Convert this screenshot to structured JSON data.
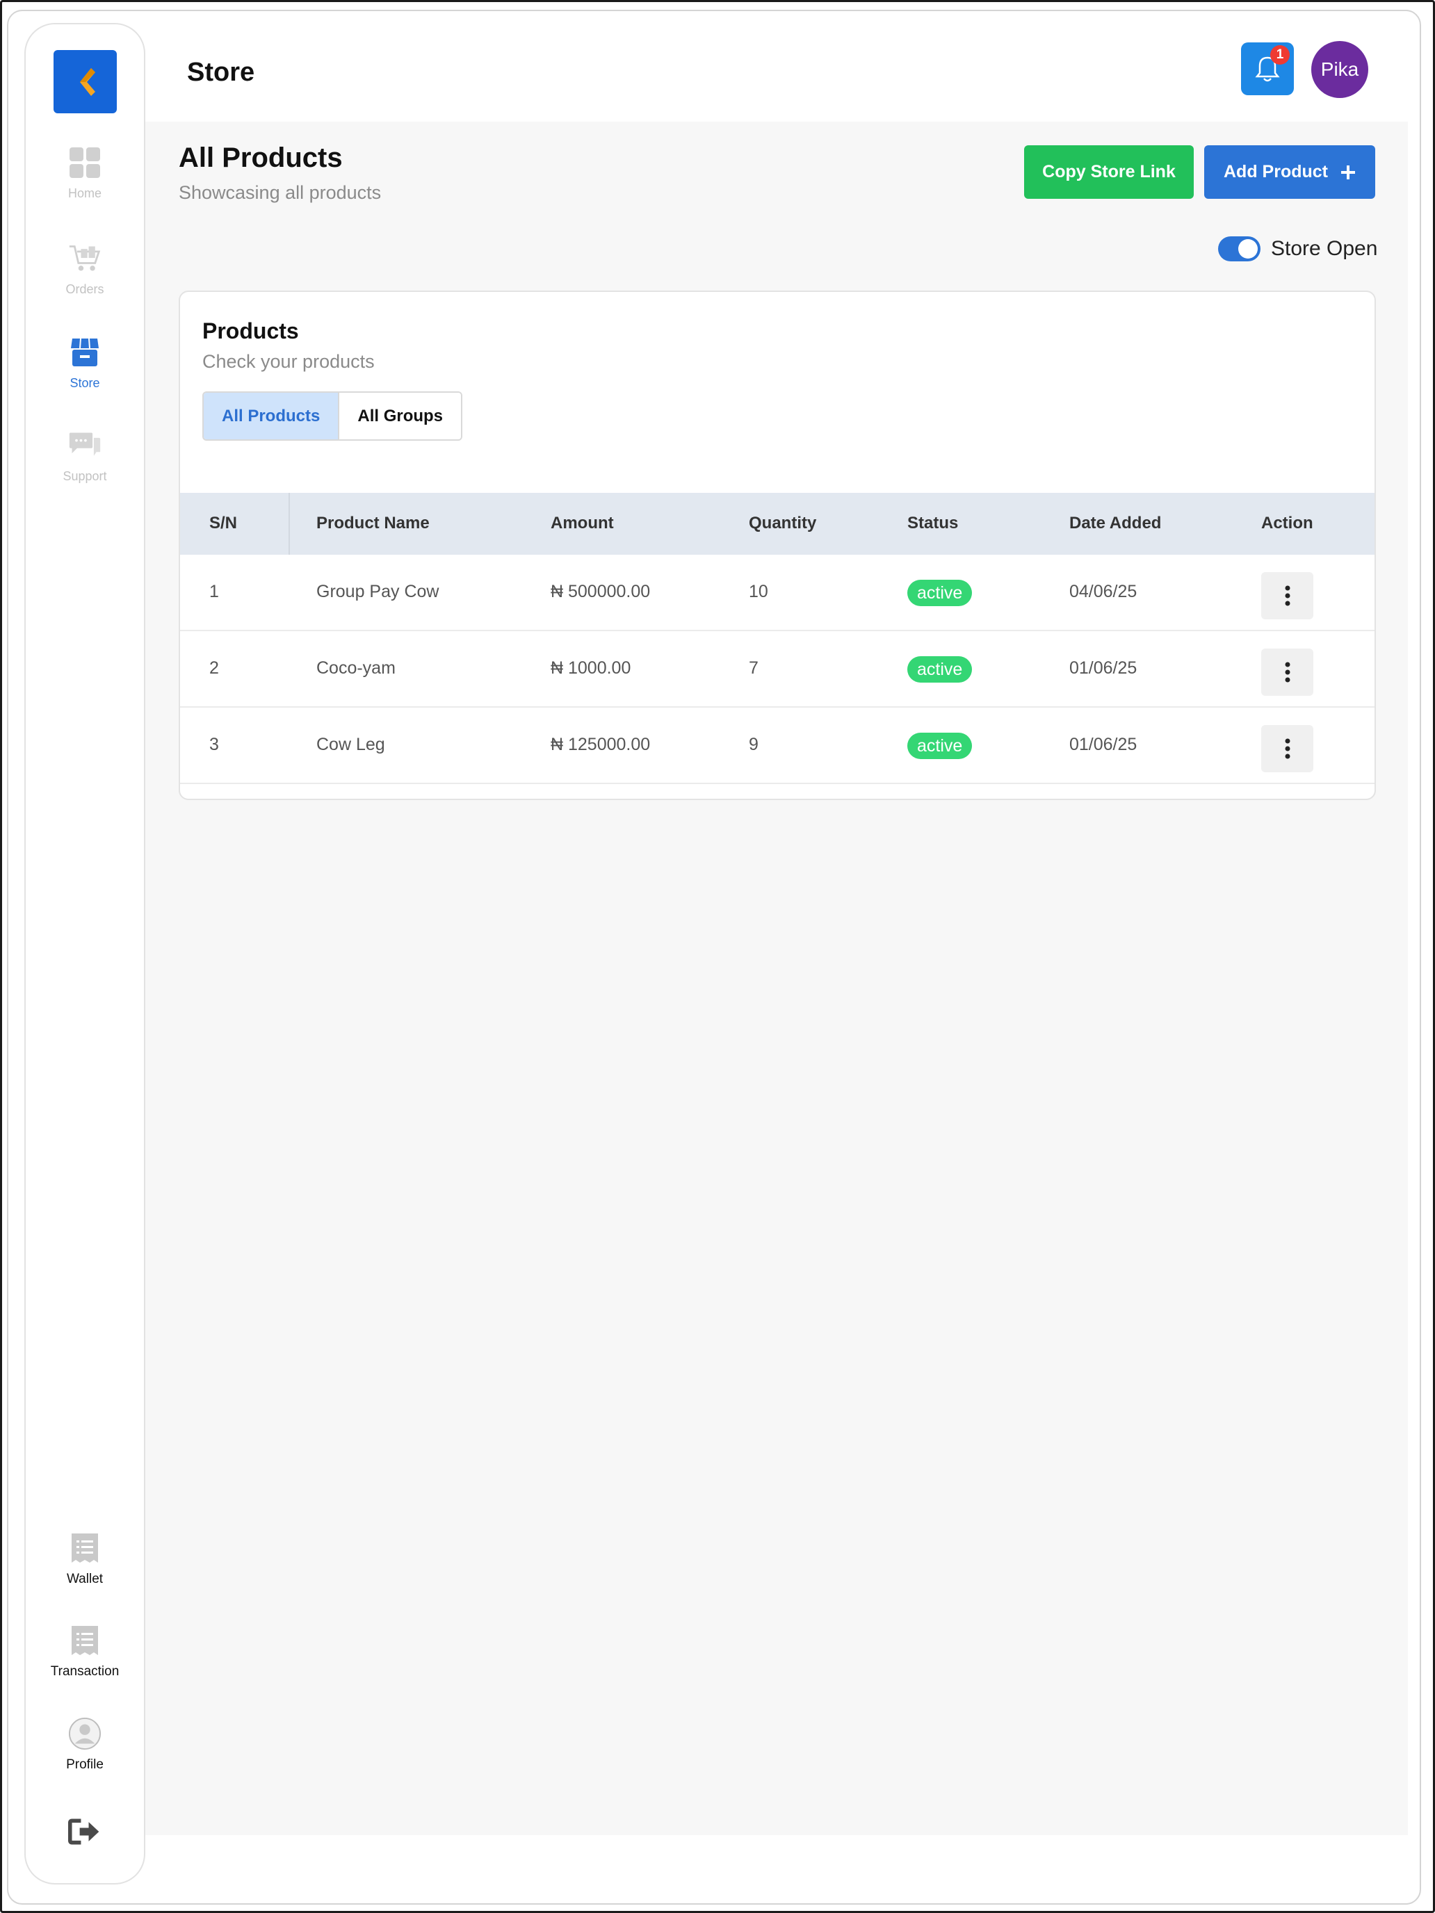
{
  "header": {
    "title": "Store",
    "notification_count": "1",
    "avatar_text": "Pika"
  },
  "sidebar": {
    "items": [
      {
        "label": "Home",
        "icon": "grid-icon",
        "active": false
      },
      {
        "label": "Orders",
        "icon": "cart-icon",
        "active": false
      },
      {
        "label": "Store",
        "icon": "store-icon",
        "active": true
      },
      {
        "label": "Support",
        "icon": "chat-icon",
        "active": false
      }
    ],
    "bottom_items": [
      {
        "label": "Wallet",
        "icon": "receipt-icon"
      },
      {
        "label": "Transaction",
        "icon": "receipt-icon"
      },
      {
        "label": "Profile",
        "icon": "user-icon"
      }
    ],
    "logout_icon": "logout-icon"
  },
  "main": {
    "title": "All Products",
    "subtitle": "Showcasing all products",
    "copy_link_label": "Copy Store Link",
    "add_product_label": "Add Product",
    "store_toggle_label": "Store Open",
    "store_open": true
  },
  "products_card": {
    "title": "Products",
    "subtitle": "Check your products",
    "tabs": [
      {
        "label": "All Products",
        "active": true
      },
      {
        "label": "All Groups",
        "active": false
      }
    ],
    "columns": [
      "S/N",
      "Product Name",
      "Amount",
      "Quantity",
      "Status",
      "Date Added",
      "Action"
    ],
    "rows": [
      {
        "sn": "1",
        "name": "Group Pay Cow",
        "amount": "₦ 500000.00",
        "quantity": "10",
        "status": "active",
        "date": "04/06/25"
      },
      {
        "sn": "2",
        "name": "Coco-yam",
        "amount": "₦ 1000.00",
        "quantity": "7",
        "status": "active",
        "date": "01/06/25"
      },
      {
        "sn": "3",
        "name": "Cow Leg",
        "amount": "₦ 125000.00",
        "quantity": "9",
        "status": "active",
        "date": "01/06/25"
      }
    ]
  },
  "colors": {
    "primary": "#2c74d6",
    "success": "#22c05a",
    "status_active": "#34d674",
    "avatar": "#6b2c9e",
    "badge": "#ef3b32"
  }
}
